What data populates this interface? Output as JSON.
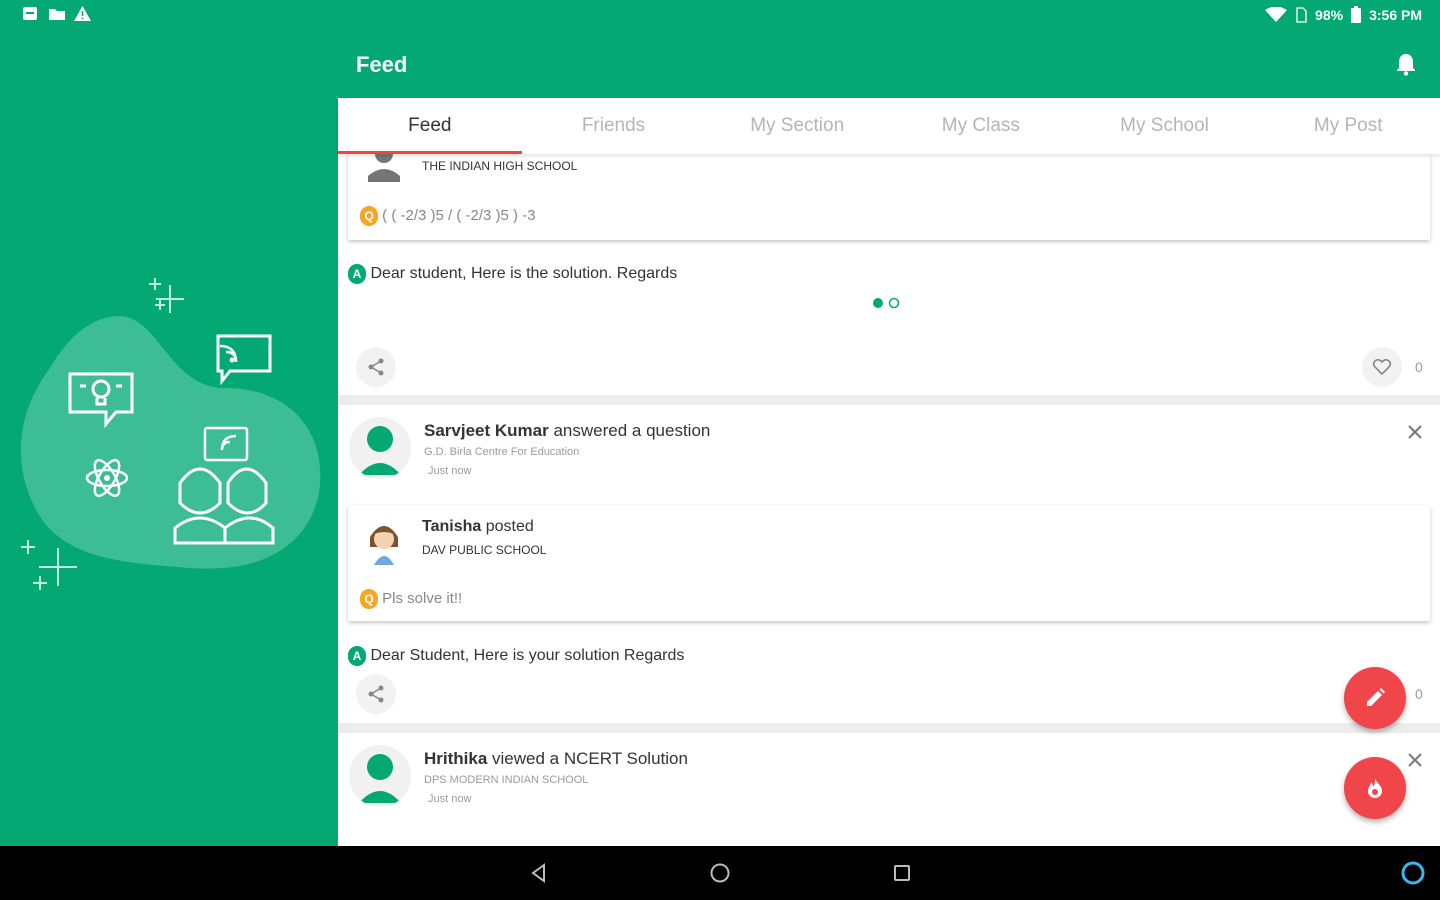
{
  "status_bar": {
    "battery": "98%",
    "time": "3:56 PM"
  },
  "app_bar": {
    "title": "Feed"
  },
  "tabs": [
    {
      "label": "Feed",
      "active": true
    },
    {
      "label": "Friends"
    },
    {
      "label": "My Section"
    },
    {
      "label": "My Class"
    },
    {
      "label": "My School"
    },
    {
      "label": "My Post"
    }
  ],
  "posts": [
    {
      "school": "THE INDIAN HIGH SCHOOL",
      "question": "( ( -2/3 )5 / ( -2/3 )5 ) -3",
      "answer": "Dear student, Here is the solution. Regards",
      "likes": "0"
    },
    {
      "user": "Sarvjeet Kumar",
      "action": "answered a question",
      "school": "G.D. Birla Centre For Education",
      "time": "Just now",
      "inner": {
        "user": "Tanisha",
        "action": "posted",
        "school": "DAV PUBLIC SCHOOL",
        "question": "Pls solve it!!"
      },
      "answer": "Dear Student, Here is your solution Regards",
      "likes": "0"
    },
    {
      "user": "Hrithika",
      "action": "viewed a NCERT Solution",
      "school": "DPS MODERN INDIAN SCHOOL",
      "time": "Just now"
    }
  ],
  "badges": {
    "question": "Q",
    "answer": "A"
  },
  "colors": {
    "primary": "#03a873",
    "accent": "#f0464a",
    "question_badge": "#f5a623"
  }
}
